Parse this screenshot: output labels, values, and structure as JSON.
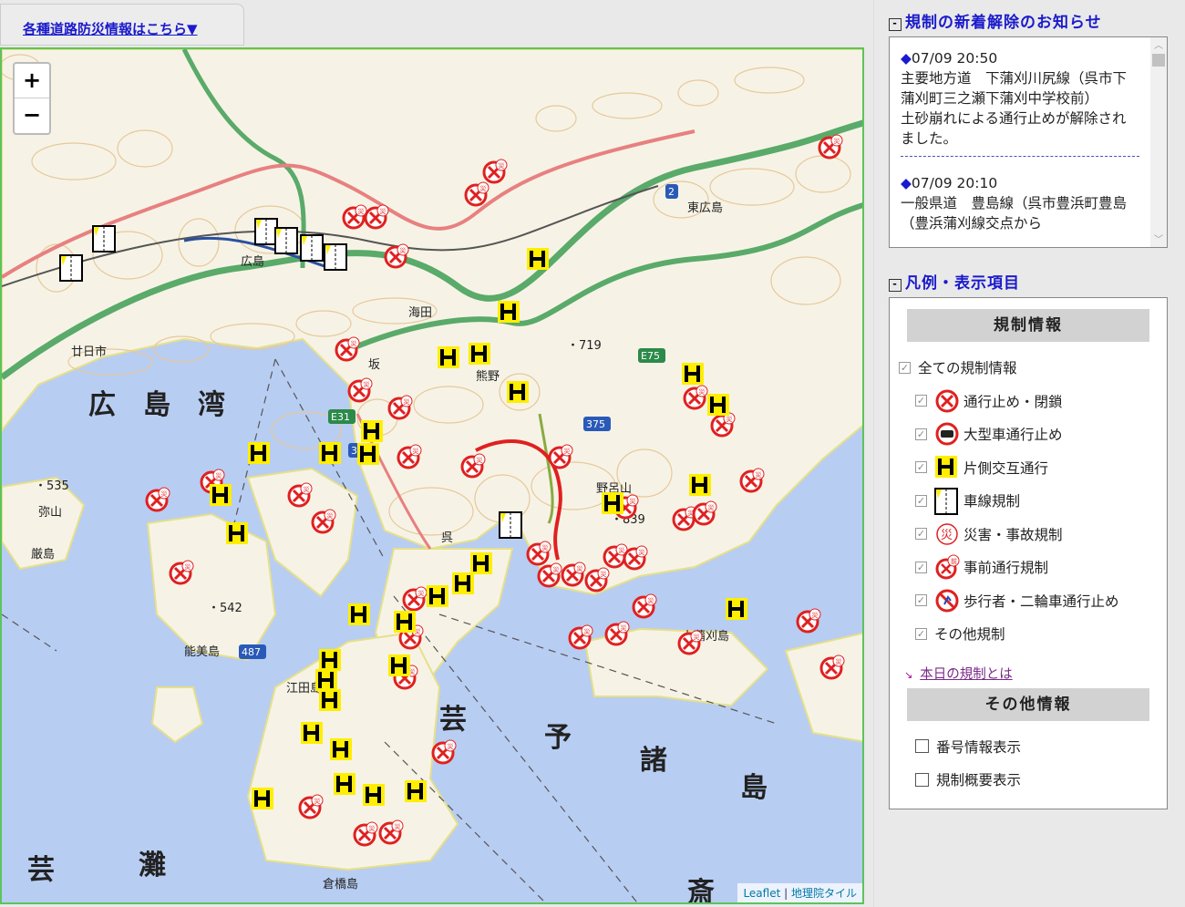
{
  "top_link": "各種道路防災情報はこちら▼",
  "map": {
    "zoom_in": "+",
    "zoom_out": "−",
    "attribution": {
      "leaflet": "Leaflet",
      "tiles": "地理院タイル"
    },
    "labels": [
      {
        "text": "広　島　湾",
        "size": "big"
      },
      {
        "text": "芸",
        "size": "big"
      },
      {
        "text": "予",
        "size": "big"
      },
      {
        "text": "諸",
        "size": "big"
      },
      {
        "text": "島",
        "size": "big"
      },
      {
        "text": "芸",
        "size": "big"
      },
      {
        "text": "灘",
        "size": "big"
      },
      {
        "text": "斎",
        "size": "big"
      },
      {
        "text": "広島",
        "size": "small"
      },
      {
        "text": "廿日市",
        "size": "small"
      },
      {
        "text": "海田",
        "size": "small"
      },
      {
        "text": "坂",
        "size": "small"
      },
      {
        "text": "熊野",
        "size": "small"
      },
      {
        "text": "呉",
        "size": "small"
      },
      {
        "text": "江田島",
        "size": "small"
      },
      {
        "text": "東広島",
        "size": "small"
      },
      {
        "text": "野呂山",
        "size": "small"
      },
      {
        "text": "能美島",
        "size": "small"
      },
      {
        "text": "弥山",
        "size": "small"
      },
      {
        "text": "厳島",
        "size": "small"
      },
      {
        "text": "倉橋島",
        "size": "small"
      },
      {
        "text": "上蒲刈島",
        "size": "small"
      },
      {
        "text": "・719",
        "size": "small"
      },
      {
        "text": "・535",
        "size": "small"
      },
      {
        "text": "・542",
        "size": "small"
      },
      {
        "text": "・839",
        "size": "small"
      },
      {
        "text": "E75",
        "size": "shield"
      },
      {
        "text": "E31",
        "size": "shield"
      },
      {
        "text": "375",
        "size": "shield"
      },
      {
        "text": "487",
        "size": "shield"
      },
      {
        "text": "2",
        "size": "shield"
      },
      {
        "text": "31",
        "size": "shield"
      }
    ]
  },
  "news": {
    "title": "規制の新着解除のお知らせ",
    "items": [
      {
        "time": "07/09 20:50",
        "text": "主要地方道　下蒲刈川尻線（呉市下蒲刈町三之瀬下蒲刈中学校前）\n土砂崩れによる通行止めが解除されました。"
      },
      {
        "time": "07/09 20:10",
        "text": "一般県道　豊島線（呉市豊浜町豊島（豊浜蒲刈線交点から"
      }
    ]
  },
  "legend": {
    "title": "凡例・表示項目",
    "reg_header": "規制情報",
    "all_label": "全ての規制情報",
    "items": [
      {
        "label": "通行止め・閉鎖",
        "icon": "closure-icon",
        "checked": true
      },
      {
        "label": "大型車通行止め",
        "icon": "large-vehicle-closure-icon",
        "checked": true
      },
      {
        "label": "片側交互通行",
        "icon": "alternating-traffic-icon",
        "checked": true
      },
      {
        "label": "車線規制",
        "icon": "lane-restriction-icon",
        "checked": true
      },
      {
        "label": "災害・事故規制",
        "icon": "disaster-icon",
        "checked": true
      },
      {
        "label": "事前通行規制",
        "icon": "precaution-icon",
        "checked": true
      },
      {
        "label": "歩行者・二輪車通行止め",
        "icon": "pedestrian-closure-icon",
        "checked": true
      },
      {
        "label": "その他規制",
        "icon": "",
        "checked": true
      }
    ],
    "today_link": "本日の規制とは",
    "other_header": "その他情報",
    "other_items": [
      {
        "label": "番号情報表示",
        "checked": false
      },
      {
        "label": "規制概要表示",
        "checked": false
      }
    ]
  },
  "colors": {
    "sea": "#b8cdf2",
    "land": "#f6f3e6",
    "closure": "#e02020",
    "alt": "#ffee00",
    "link": "#1a1acc"
  }
}
